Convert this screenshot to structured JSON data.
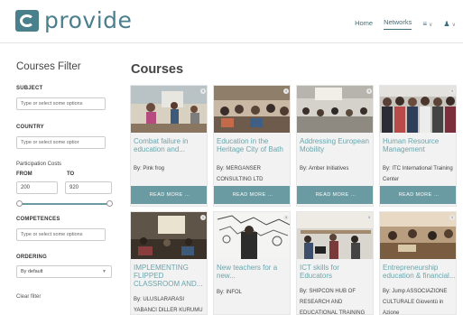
{
  "header": {
    "logo_text": "provide",
    "nav": {
      "home": "Home",
      "networks": "Networks"
    }
  },
  "sidebar": {
    "title": "Courses Filter",
    "subject": {
      "label": "SUBJECT",
      "placeholder": "Type or select some options"
    },
    "country": {
      "label": "COUNTRY",
      "placeholder": "Type or select some optior"
    },
    "costs": {
      "label": "Participation Costs",
      "from_label": "FROM",
      "to_label": "TO",
      "from_value": "200",
      "to_value": "920"
    },
    "competences": {
      "label": "COMPETENCES",
      "placeholder": "Type or select some options"
    },
    "ordering": {
      "label": "ORDERING",
      "value": "By default"
    },
    "clear": "Clear filter"
  },
  "main": {
    "title": "Courses",
    "read_more": "READ MORE ...",
    "cards": [
      {
        "title": "Combat failure in education and...",
        "by": "By: Pink frog"
      },
      {
        "title": "Education in the Heritage City of Bath",
        "by": "By: MERGANSER CONSULTING LTD"
      },
      {
        "title": "Addressing European Mobility",
        "by": "By: Amber Initiatives"
      },
      {
        "title": "Human Resource Management",
        "by": "By: ITC International Training Center"
      },
      {
        "title": "IMPLEMENTING FLIPPED CLASSROOM AND...",
        "by": "By: ULUSLARARASI YABANCI DILLER KURUMU"
      },
      {
        "title": "New teachers for a new...",
        "by": "By: INFOL"
      },
      {
        "title": "ICT skills for Educators",
        "by": "By: SHIPCON HUB OF RESEARCH AND EDUCATIONAL TRAINING"
      },
      {
        "title": "Entrepreneurship education & financial...",
        "by": "By: Jump ASSOCIAZIONE CULTURALE Gioventù in Azione"
      }
    ]
  },
  "colors": {
    "accent": "#4a7f8c",
    "button": "#6a9ba2",
    "title_link": "#6aa6ad"
  },
  "icons": {
    "logo": "provide-logo-icon",
    "menu": "hamburger-icon",
    "user": "user-icon",
    "info": "info-icon"
  }
}
